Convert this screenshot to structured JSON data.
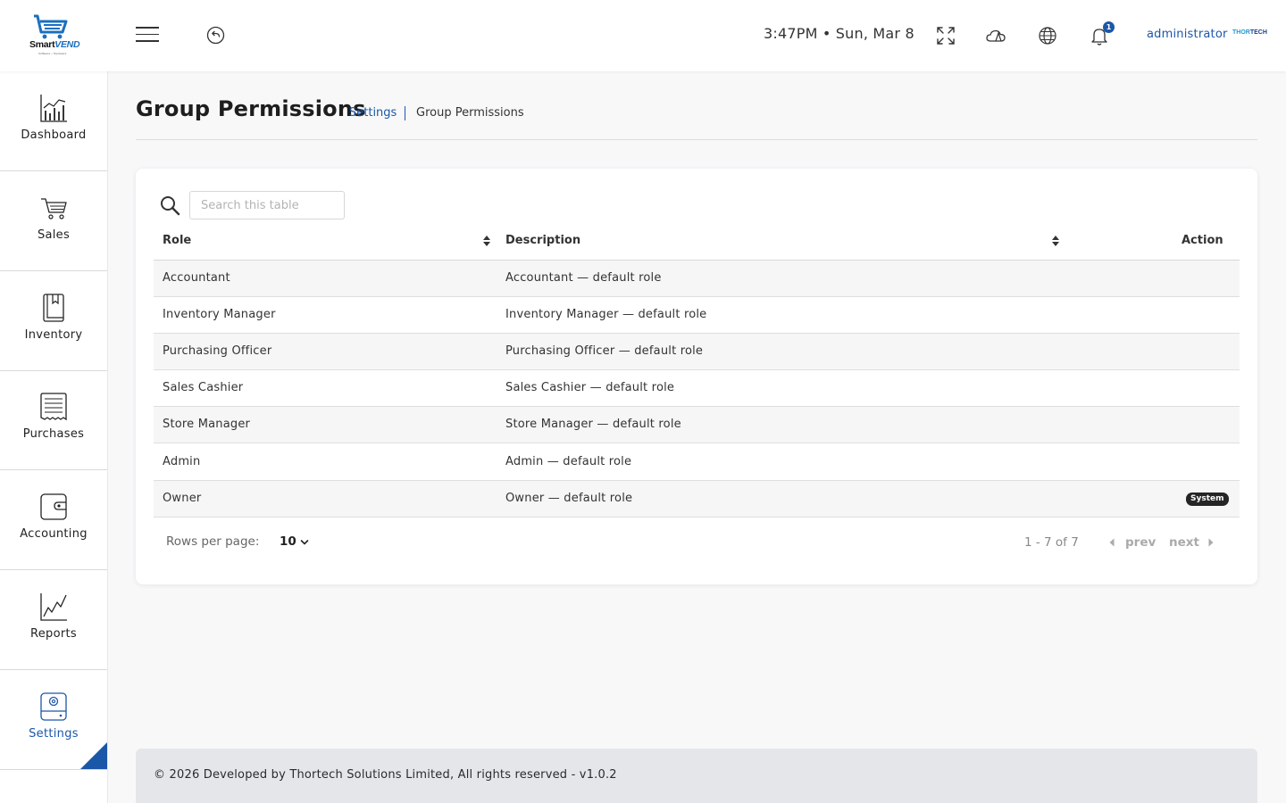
{
  "header": {
    "logo": {
      "brand_part1": "Smart",
      "brand_part2": "VEND",
      "tagline": "Software • Hardware"
    },
    "clock": "3:47PM • Sun, Mar 8",
    "notification_count": "1",
    "user_name": "administrator",
    "company_logo": {
      "part1": "THOR",
      "part2": "TECH"
    },
    "icons": [
      "menu-icon",
      "back-icon",
      "fullscreen-icon",
      "weather-icon",
      "globe-icon",
      "bell-icon"
    ]
  },
  "sidebar": {
    "items": [
      {
        "label": "Dashboard",
        "icon": "chart-icon"
      },
      {
        "label": "Sales",
        "icon": "cart-icon"
      },
      {
        "label": "Inventory",
        "icon": "book-icon"
      },
      {
        "label": "Purchases",
        "icon": "receipt-icon"
      },
      {
        "label": "Accounting",
        "icon": "wallet-icon"
      },
      {
        "label": "Reports",
        "icon": "line-chart-icon"
      },
      {
        "label": "Settings",
        "icon": "settings-icon",
        "active": true
      }
    ]
  },
  "page": {
    "title": "Group Permissions",
    "breadcrumb": {
      "parent": "Settings",
      "current": "Group Permissions"
    }
  },
  "table": {
    "search_placeholder": "Search this table",
    "columns": {
      "role": "Role",
      "description": "Description",
      "action": "Action"
    },
    "rows": [
      {
        "role": "Accountant",
        "description": "Accountant — default role",
        "badge": ""
      },
      {
        "role": "Inventory Manager",
        "description": "Inventory Manager — default role",
        "badge": ""
      },
      {
        "role": "Purchasing Officer",
        "description": "Purchasing Officer — default role",
        "badge": ""
      },
      {
        "role": "Sales Cashier",
        "description": "Sales Cashier — default role",
        "badge": ""
      },
      {
        "role": "Store Manager",
        "description": "Store Manager — default role",
        "badge": ""
      },
      {
        "role": "Admin",
        "description": "Admin — default role",
        "badge": ""
      },
      {
        "role": "Owner",
        "description": "Owner — default role",
        "badge": "System"
      }
    ],
    "pagination": {
      "rows_per_page_label": "Rows per page:",
      "rows_per_page_value": "10",
      "range": "1 - 7 of 7",
      "prev": "prev",
      "next": "next"
    }
  },
  "footer": {
    "text": "© 2026 Developed by Thortech Solutions Limited, All rights reserved - v1.0.2"
  },
  "colors": {
    "accent": "#1b57a8",
    "badge_bg": "#252525",
    "footer_bg": "#e5e6ea"
  }
}
